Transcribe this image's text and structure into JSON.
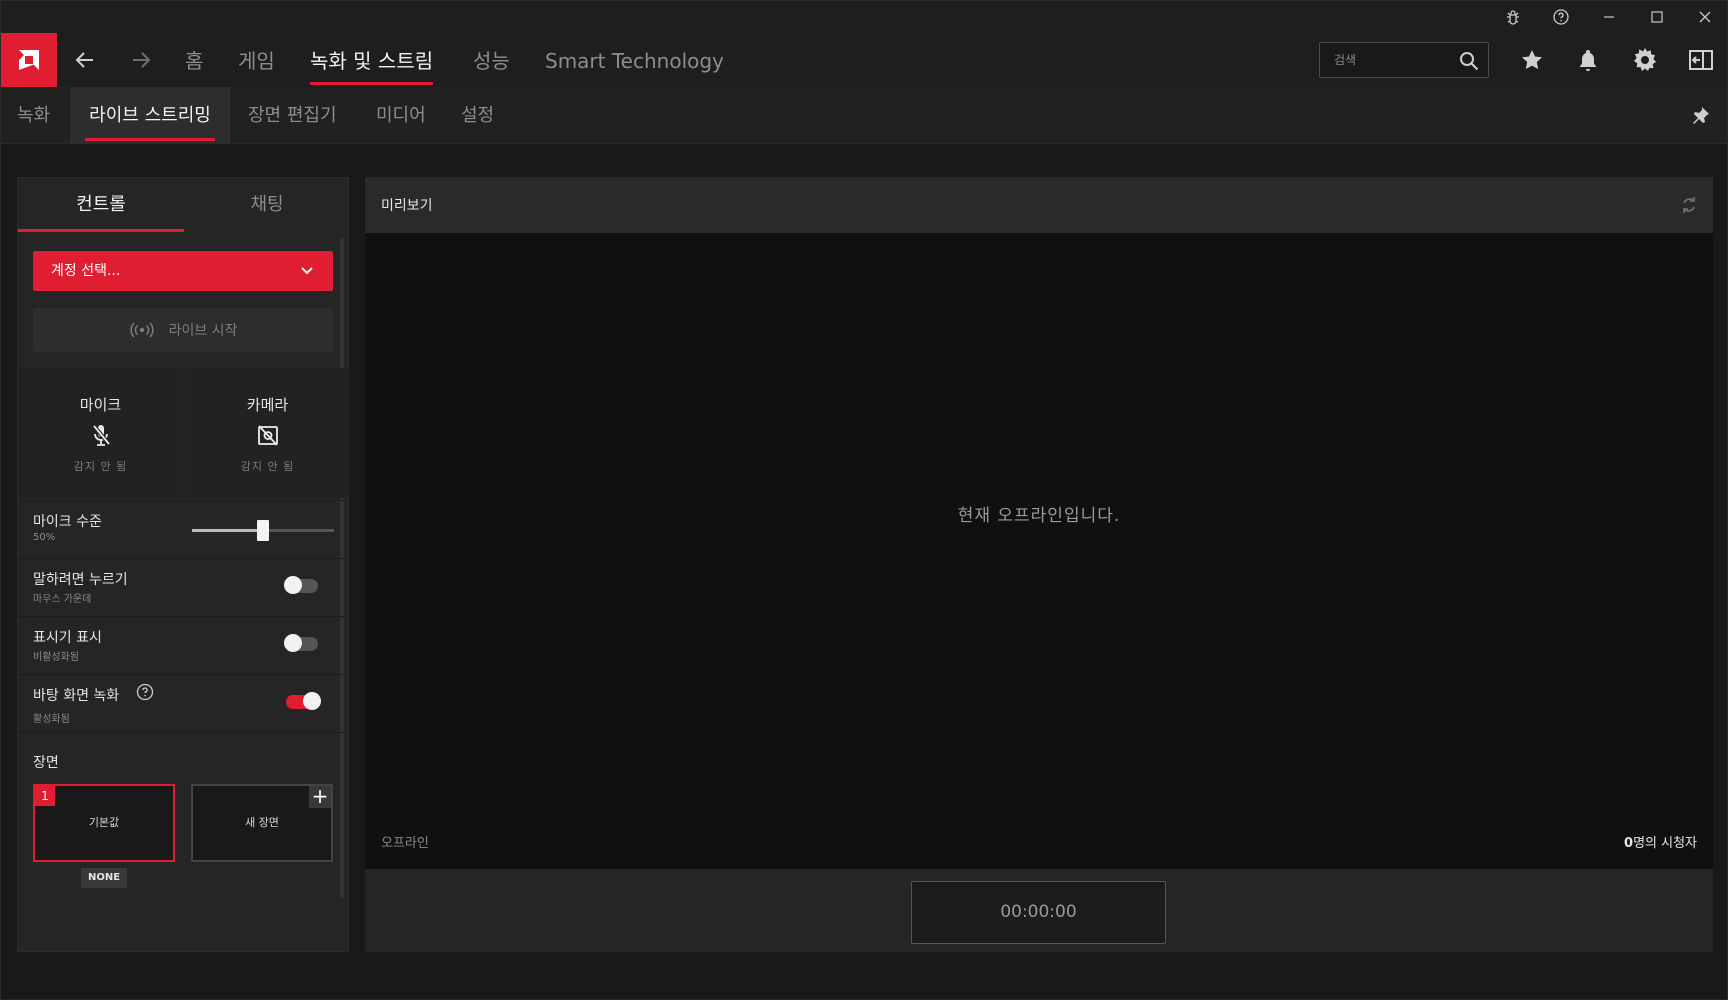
{
  "nav": {
    "items": [
      "홈",
      "게임",
      "녹화 및 스트림",
      "성능",
      "Smart Technology"
    ],
    "active_index": 2,
    "search_placeholder": "검색"
  },
  "subnav": {
    "items": [
      "녹화",
      "라이브 스트리밍",
      "장면 편집기",
      "미디어",
      "설정"
    ],
    "active_index": 1
  },
  "left_panel": {
    "tabs": [
      "컨트롤",
      "채팅"
    ],
    "account_select": "계정 선택...",
    "live_start": "라이브 시작",
    "mic": {
      "title": "마이크",
      "status": "감지 안 됨"
    },
    "camera": {
      "title": "카메라",
      "status": "감지 안 됨"
    },
    "mic_level": {
      "label": "마이크 수준",
      "value": "50%",
      "level": 0.5
    },
    "push_to_talk": {
      "label": "말하려면 누르기",
      "sub": "마우스 가운데",
      "on": false
    },
    "show_indicator": {
      "label": "표시기 표시",
      "sub": "비활성화됨",
      "on": false
    },
    "desktop_record": {
      "label": "바탕 화면 녹화",
      "sub": "활성화됨",
      "on": true
    },
    "scenes_label": "장면",
    "scenes": [
      {
        "num": "1",
        "name": "기본값"
      },
      {
        "name": "새 장면"
      }
    ],
    "scene_hotkey": "NONE"
  },
  "preview": {
    "title": "미리보기",
    "offline_message": "현재 오프라인입니다.",
    "status": "오프라인",
    "viewers_count": "0",
    "viewers_suffix": "명의 시청자",
    "timer": "00:00:00"
  },
  "colors": {
    "accent": "#e11d32"
  }
}
